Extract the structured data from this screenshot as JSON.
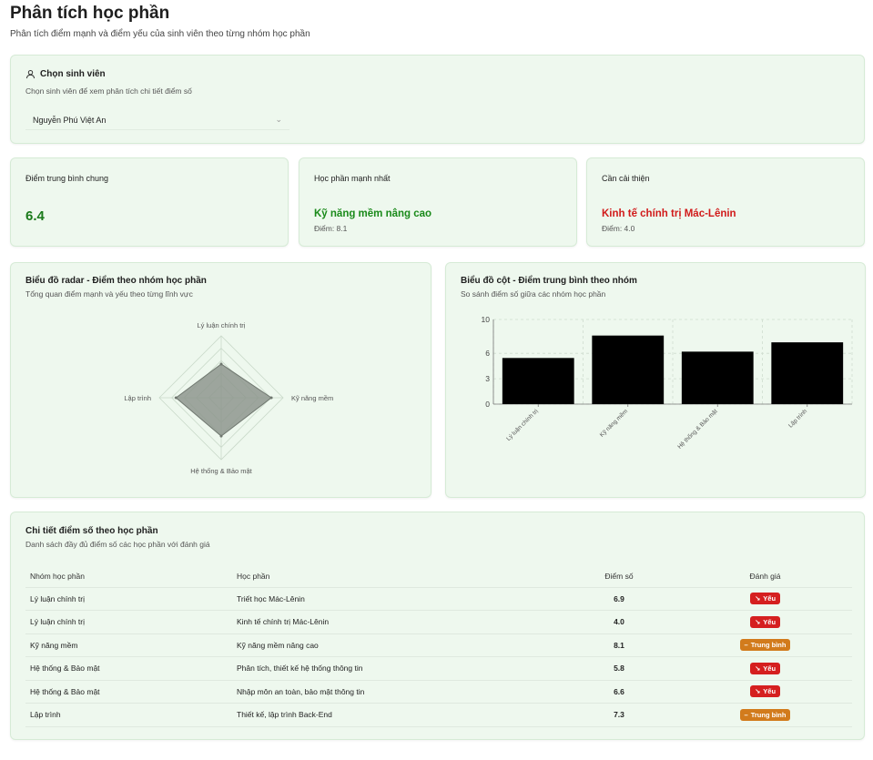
{
  "header": {
    "title": "Phân tích học phần",
    "subtitle": "Phân tích điểm mạnh và điểm yếu của sinh viên theo từng nhóm học phần"
  },
  "student_select": {
    "title": "Chọn sinh viên",
    "description": "Chọn sinh viên để xem phân tích chi tiết điểm số",
    "selected": "Nguyễn Phú Việt An",
    "icon": "user-icon"
  },
  "stats": {
    "average": {
      "label": "Điểm trung bình chung",
      "value": "6.4"
    },
    "strongest": {
      "label": "Học phần mạnh nhất",
      "value": "Kỹ năng mềm nâng cao",
      "score": "Điểm: 8.1",
      "color": "#1a8a1a"
    },
    "improve": {
      "label": "Cần cải thiện",
      "value": "Kinh tế chính trị Mác-Lênin",
      "score": "Điểm: 4.0",
      "color": "#d11a1a"
    }
  },
  "radar": {
    "title": "Biểu đồ radar - Điểm theo nhóm học phần",
    "description": "Tổng quan điểm mạnh và yếu theo từng lĩnh vực"
  },
  "bar": {
    "title": "Biểu đồ cột - Điểm trung bình theo nhóm",
    "description": "So sánh điểm số giữa các nhóm học phần"
  },
  "chart_data": [
    {
      "type": "radar",
      "categories": [
        "Lý luận chính trị",
        "Kỹ năng mềm",
        "Hệ thống & Bảo mật",
        "Lập trình"
      ],
      "values": [
        5.45,
        8.1,
        6.2,
        7.3
      ],
      "range": [
        0,
        10
      ],
      "grid": true
    },
    {
      "type": "bar",
      "categories": [
        "Lý luận chính trị",
        "Kỹ năng mềm",
        "Hệ thống & Bảo mật",
        "Lập trình"
      ],
      "values": [
        5.45,
        8.1,
        6.2,
        7.3
      ],
      "ylim": [
        0,
        10
      ],
      "yticks": [
        0,
        3,
        6,
        10
      ],
      "grid": true,
      "bar_color": "#000000"
    }
  ],
  "table": {
    "title": "Chi tiết điểm số theo học phần",
    "description": "Danh sách đầy đủ điểm số các học phần với đánh giá",
    "columns": [
      "Nhóm học phần",
      "Học phần",
      "Điểm số",
      "Đánh giá"
    ],
    "rows": [
      {
        "group": "Lý luận chính trị",
        "course": "Triết học Mác-Lênin",
        "score": "6.9",
        "eval": "Yếu",
        "level": "weak"
      },
      {
        "group": "Lý luận chính trị",
        "course": "Kinh tế chính trị Mác-Lênin",
        "score": "4.0",
        "eval": "Yếu",
        "level": "weak"
      },
      {
        "group": "Kỹ năng mềm",
        "course": "Kỹ năng mềm nâng cao",
        "score": "8.1",
        "eval": "Trung bình",
        "level": "avg"
      },
      {
        "group": "Hệ thống & Bảo mật",
        "course": "Phân tích, thiết kế hệ thống thông tin",
        "score": "5.8",
        "eval": "Yếu",
        "level": "weak"
      },
      {
        "group": "Hệ thống & Bảo mật",
        "course": "Nhập môn an toàn, bảo mật thông tin",
        "score": "6.6",
        "eval": "Yếu",
        "level": "weak"
      },
      {
        "group": "Lập trình",
        "course": "Thiết kế, lập trình Back-End",
        "score": "7.3",
        "eval": "Trung bình",
        "level": "avg"
      }
    ]
  }
}
